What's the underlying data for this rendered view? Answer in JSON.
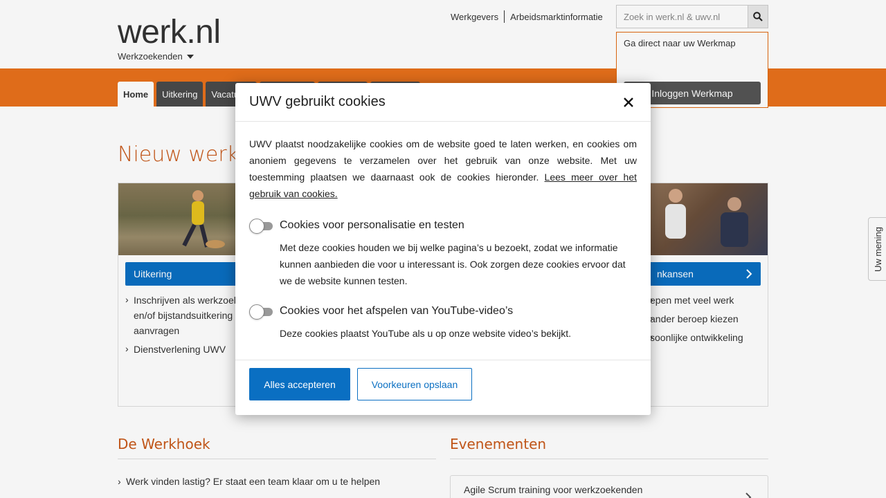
{
  "header": {
    "logo": "werk.nl",
    "audience": "Werkzoekenden",
    "links": [
      "Werkgevers",
      "Arbeidsmarktinformatie"
    ],
    "search_placeholder": "Zoek in werk.nl & uwv.nl",
    "workmap": {
      "title": "Ga direct naar uw Werkmap",
      "button": "Inloggen Werkmap"
    }
  },
  "nav": {
    "tabs": [
      "Home",
      "Uitkering",
      "Vacatures",
      "",
      "",
      ""
    ]
  },
  "main": {
    "title": "Nieuw werk vi",
    "cards": [
      {
        "bar": "Uitkering",
        "items": [
          "Inschrijven als werkzoekende en/of bijstandsuitkering aanvragen",
          "Dienstverlening UWV"
        ]
      },
      {
        "bar": "nkansen",
        "items": [
          "epen met veel werk",
          "ander beroep kiezen",
          "soonlijke ontwikkeling"
        ]
      }
    ],
    "werkhoek": {
      "title": "De Werkhoek",
      "link": "Werk vinden lastig? Er staat een team klaar om u te helpen"
    },
    "evenementen": {
      "title": "Evenementen",
      "item": "Agile Scrum training voor werkzoekenden"
    },
    "feedback": "Uw mening"
  },
  "modal": {
    "title": "UWV gebruikt cookies",
    "intro": "UWV plaatst noodzakelijke cookies om de website goed te laten werken, en cookies om anoniem gegevens te verzamelen over het gebruik van onze website. Met uw toestemming plaatsen we daarnaast ook de cookies hieronder.",
    "intro_link": "Lees meer over het gebruik van cookies.",
    "options": [
      {
        "label": "Cookies voor personalisatie en testen",
        "desc": "Met deze cookies houden we bij welke pagina’s u bezoekt, zodat we informatie kunnen aanbieden die voor u interessant is. Ook zorgen deze cookies ervoor dat we de website kunnen testen.",
        "enabled": false
      },
      {
        "label": "Cookies voor het afspelen van YouTube-video’s",
        "desc": "Deze cookies plaatst YouTube als u op onze website video’s bekijkt.",
        "enabled": false
      }
    ],
    "accept_button": "Alles accepteren",
    "save_button": "Voorkeuren opslaan"
  },
  "colors": {
    "orange": "#e9711c",
    "blue": "#0a6fc2",
    "title_orange": "#c8591a"
  }
}
